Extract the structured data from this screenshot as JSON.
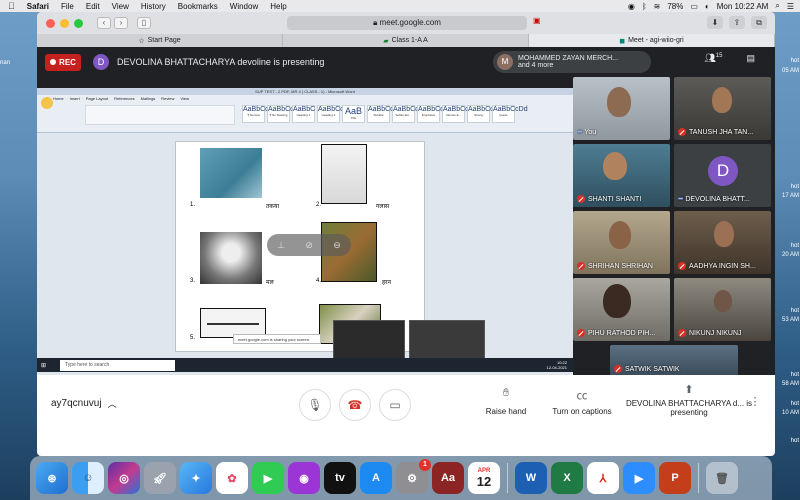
{
  "menubar": {
    "app": "Safari",
    "menus": [
      "File",
      "Edit",
      "View",
      "History",
      "Bookmarks",
      "Window",
      "Help"
    ],
    "battery": "78%",
    "clock": "Mon 10:22 AM"
  },
  "browser": {
    "address": "meet.google.com",
    "tabs": [
      {
        "label": "Start Page"
      },
      {
        "label": "Class 1-A A"
      },
      {
        "label": "Meet - agi-wiio-gri"
      }
    ]
  },
  "meet": {
    "rec_label": "REC",
    "presenter_initial": "D",
    "presenting_text": "DEVOLINA BHATTACHARYA devoline is presenting",
    "others_initial": "M",
    "others_name": "MOHAMMED ZAYAN MERCH...",
    "others_more": "and 4 more",
    "participants_count": "15",
    "meeting_code": "ay7qcnuvuj",
    "raise_hand": "Raise hand",
    "captions": "Turn on captions",
    "presenting_footer": "DEVOLINA BHATTACHARYA d... is presenting"
  },
  "word": {
    "title": "SUP TEST - 2 PDF, MR 4 ( CLASS - 1) - Microsoft Word",
    "tabs": [
      "Home",
      "Insert",
      "Page Layout",
      "References",
      "Mailings",
      "Review",
      "View"
    ],
    "styles": [
      {
        "preview": "AaBbCcDd",
        "name": "¶ Normal"
      },
      {
        "preview": "AaBbCcDd",
        "name": "¶ No Spacing"
      },
      {
        "preview": "AaBbC",
        "name": "Heading 1"
      },
      {
        "preview": "AaBbCc",
        "name": "Heading 2"
      },
      {
        "preview": "AaB",
        "name": "Title"
      },
      {
        "preview": "AaBbCc",
        "name": "Subtitle"
      },
      {
        "preview": "AaBbCcDd",
        "name": "Subtle Em..."
      },
      {
        "preview": "AaBbCcDd",
        "name": "Emphasis"
      },
      {
        "preview": "AaBbCcDd",
        "name": "Intense E..."
      },
      {
        "preview": "AaBbCcDd",
        "name": "Strong"
      },
      {
        "preview": "AaBbCcDd",
        "name": "Quote"
      }
    ],
    "questions": [
      {
        "num": "1.",
        "word": "तकया"
      },
      {
        "num": "2.",
        "word": "गलास"
      },
      {
        "num": "3.",
        "word": "मल"
      },
      {
        "num": "4.",
        "word": "हरन"
      },
      {
        "num": "5.",
        "word": "तर"
      },
      {
        "num": "6.",
        "word": ""
      }
    ],
    "share_notice": "meet.google.com is sharing your screen.",
    "taskbar_search": "Type here to search",
    "taskbar_time": "10:22",
    "taskbar_date": "12-04-2021"
  },
  "participants": [
    {
      "name": "You",
      "muted": false
    },
    {
      "name": "TANUSH JHA TAN...",
      "muted": true
    },
    {
      "name": "SHANTI SHANTI",
      "muted": true
    },
    {
      "name": "DEVOLINA BHATT...",
      "muted": false,
      "initial": "D"
    },
    {
      "name": "SHRIHAN SHRIHAN",
      "muted": true
    },
    {
      "name": "AADHYA INGIN SH...",
      "muted": true
    },
    {
      "name": "PIHU RATHOD PIH...",
      "muted": true
    },
    {
      "name": "NIKUNJ NIKUNJ",
      "muted": true
    },
    {
      "name": "SATWIK SATWIK",
      "muted": true
    }
  ],
  "edge_left": [
    "nan"
  ],
  "edge_right": [
    "hot",
    "05 AM",
    "hot",
    "17 AM",
    "hot",
    "20 AM",
    "hot",
    "53 AM",
    "hot",
    "58 AM",
    "hot",
    "10 AM",
    "hot"
  ],
  "dock": {
    "calendar_month": "APR",
    "calendar_day": "12",
    "badge": "1"
  }
}
